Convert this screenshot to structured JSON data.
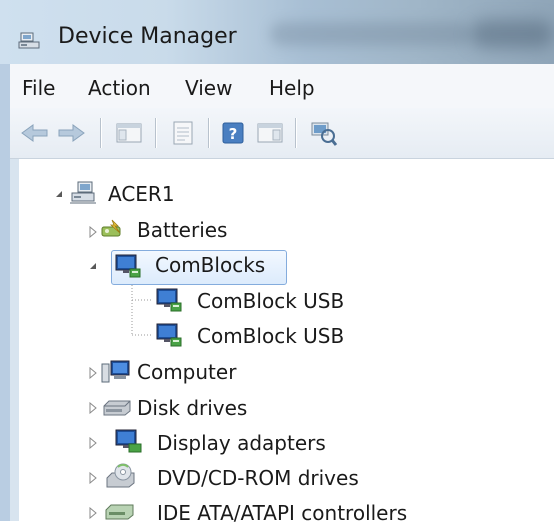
{
  "window": {
    "title": "Device Manager",
    "icon": "device-manager-icon"
  },
  "menu": {
    "items": [
      "File",
      "Action",
      "View",
      "Help"
    ]
  },
  "toolbar": {
    "buttons": [
      {
        "name": "back-button",
        "icon": "arrow-left-icon"
      },
      {
        "name": "forward-button",
        "icon": "arrow-right-icon"
      },
      {
        "name": "show-hide-console-tree-button",
        "icon": "console-tree-icon"
      },
      {
        "name": "properties-button",
        "icon": "properties-icon"
      },
      {
        "name": "help-button",
        "icon": "help-icon"
      },
      {
        "name": "show-action-pane-button",
        "icon": "action-pane-icon"
      },
      {
        "name": "scan-hardware-button",
        "icon": "scan-hardware-icon"
      }
    ]
  },
  "tree": {
    "root": {
      "label": "ACER1",
      "icon": "computer-network-icon",
      "expanded": true
    },
    "nodes": [
      {
        "label": "Batteries",
        "icon": "battery-icon",
        "expanded": false
      },
      {
        "label": "ComBlocks",
        "icon": "monitor-usb-icon",
        "expanded": true,
        "selected": true,
        "children": [
          {
            "label": "ComBlock USB",
            "icon": "monitor-usb-icon"
          },
          {
            "label": "ComBlock USB",
            "icon": "monitor-usb-icon"
          }
        ]
      },
      {
        "label": "Computer",
        "icon": "computer-icon",
        "expanded": false
      },
      {
        "label": "Disk drives",
        "icon": "disk-drive-icon",
        "expanded": false
      },
      {
        "label": "Display adapters",
        "icon": "display-adapter-icon",
        "expanded": false
      },
      {
        "label": "DVD/CD-ROM drives",
        "icon": "dvd-drive-icon",
        "expanded": false
      },
      {
        "label": "IDE ATA/ATAPI controllers",
        "icon": "ide-controller-icon",
        "expanded": false
      }
    ]
  },
  "colors": {
    "selection_border": "#84acdd",
    "selection_fill": "#dcebfc",
    "toolbar_bg": "#e6ecf3"
  }
}
